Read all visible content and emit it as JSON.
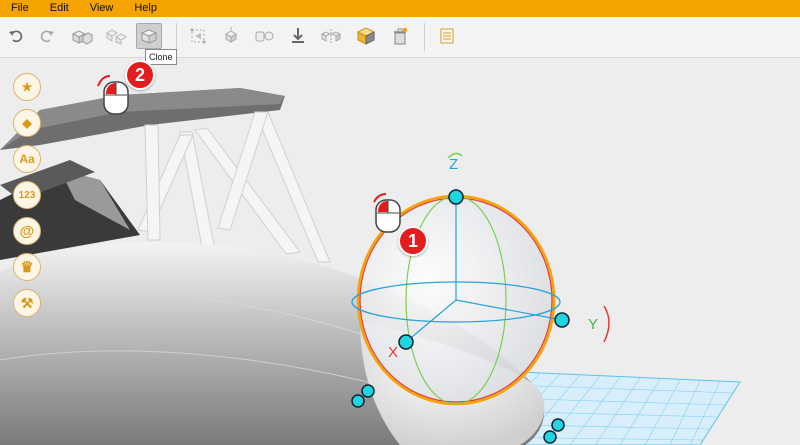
{
  "menu": {
    "items": [
      "File",
      "Edit",
      "View",
      "Help"
    ]
  },
  "toolbar": {
    "buttons": [
      "undo",
      "redo",
      "group",
      "ungroup",
      "clone",
      "align",
      "distribute",
      "center",
      "drop-to-floor",
      "mirror",
      "color",
      "delete",
      "settings"
    ],
    "tooltip": "Clone"
  },
  "palette": {
    "items": [
      {
        "name": "favorites",
        "glyph": "★"
      },
      {
        "name": "shapes",
        "glyph": "◆"
      },
      {
        "name": "text",
        "glyph": "Aa"
      },
      {
        "name": "numbers",
        "glyph": "123"
      },
      {
        "name": "symbols",
        "glyph": "@"
      },
      {
        "name": "crown",
        "glyph": "♛"
      },
      {
        "name": "tools",
        "glyph": "⚒"
      }
    ]
  },
  "gizmo": {
    "z_label": "Z",
    "y_label": "Y",
    "x_label": "X"
  },
  "callouts": {
    "one": "1",
    "two": "2"
  },
  "colors": {
    "accent": "#f5a300",
    "gizmo_z": "#4caf50",
    "gizmo_y": "#29a3d6",
    "gizmo_x": "#e53935",
    "handle": "#20d4e0"
  }
}
